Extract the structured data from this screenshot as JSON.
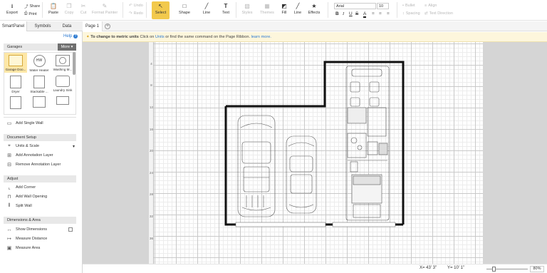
{
  "ribbon": {
    "export": "Export",
    "share": "Share",
    "print": "Print",
    "paste": "Paste",
    "copy": "Copy",
    "cut": "Cut",
    "format_painter": "Format Painter",
    "undo": "Undo",
    "redo": "Redo",
    "select": "Select",
    "shape": "Shape",
    "line": "Line",
    "text": "Text",
    "styles": "Styles",
    "themes": "Themes",
    "fill": "Fill",
    "line2": "Line",
    "effects": "Effects",
    "font_value": "Arial",
    "size_value": "10",
    "bold": "B",
    "italic": "I",
    "underline": "U",
    "strike": "S",
    "bullet": "Bullet",
    "spacing": "Spacing",
    "align": "Align",
    "text_direction": "Text Direction"
  },
  "left_tabs": {
    "smartpanel": "SmartPanel",
    "symbols": "Symbols",
    "data": "Data"
  },
  "panel": {
    "help": "Help",
    "library_title": "Garages",
    "more": "More",
    "shapes": [
      "Garage Doo...",
      "Water Heater",
      "Washing M...",
      "Dryer",
      "Stackable ...",
      "Laundry Sink",
      "",
      "",
      ""
    ],
    "water_heater_glyph": "HW",
    "add_single_wall": "Add Single Wall",
    "document_setup": "Document Setup",
    "units_scale": "Units & Scale",
    "add_annotation_layer": "Add Annotation Layer",
    "remove_annotation_layer": "Remove Annotation Layer",
    "adjust": "Adjust",
    "add_corner": "Add Corner",
    "add_wall_opening": "Add Wall Opening",
    "split_wall": "Split Wall",
    "dimensions_area": "Dimensions & Area",
    "show_dimensions": "Show Dimensions",
    "measure_distance": "Measure Distance",
    "measure_area": "Measure Area"
  },
  "page_tabs": {
    "page1": "Page 1",
    "add": "+"
  },
  "tip": {
    "lead": "To change to metric units",
    "mid1": " Click on ",
    "units_link": "Units",
    "mid2": " or find the same command on the Page Ribbon. ",
    "learn_more": "learn more."
  },
  "ruler": [
    "4",
    "8",
    "12",
    "16",
    "20",
    "24",
    "28",
    "32",
    "36"
  ],
  "status": {
    "x": "X= 43' 3\"",
    "y": "Y= 10' 1\"",
    "zoom": "80%"
  },
  "colors": {
    "accent_select": "#f2c94c",
    "link": "#2e7bd1",
    "tip_bg": "#fdf6dc"
  }
}
